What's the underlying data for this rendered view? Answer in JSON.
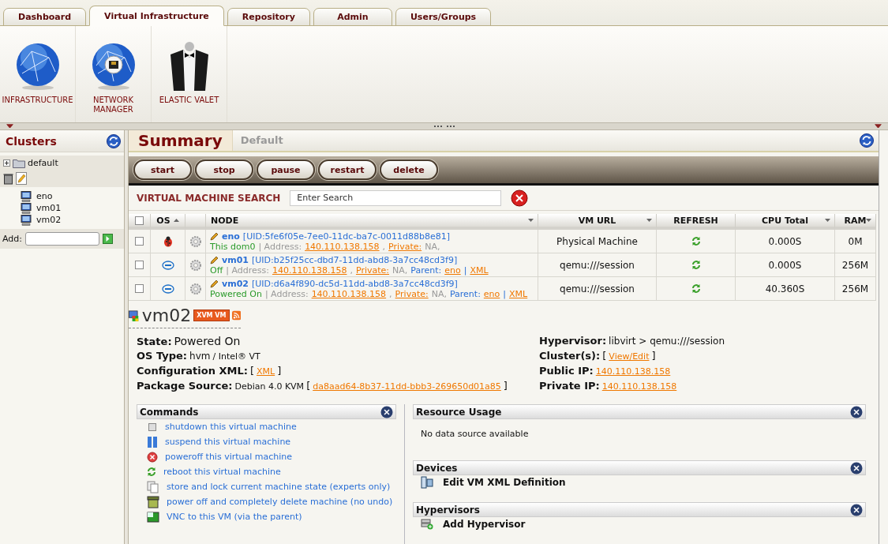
{
  "tabs": [
    {
      "label": "Dashboard",
      "selected": false
    },
    {
      "label": "Virtual Infrastructure",
      "selected": true
    },
    {
      "label": "Repository",
      "selected": false
    },
    {
      "label": "Admin",
      "selected": false
    },
    {
      "label": "Users/Groups",
      "selected": false
    }
  ],
  "launchers": [
    {
      "label": "INFRASTRUCTURE",
      "kind": "globe"
    },
    {
      "label": "NETWORK MANAGER",
      "kind": "network"
    },
    {
      "label": "ELASTIC VALET",
      "kind": "valet"
    }
  ],
  "sidebar": {
    "title": "Clusters",
    "tree": [
      {
        "label": "default",
        "children": [
          {
            "label": "eno"
          },
          {
            "label": "vm01"
          },
          {
            "label": "vm02"
          }
        ]
      }
    ],
    "add_label": "Add:"
  },
  "main": {
    "tabs": [
      {
        "label": "Summary",
        "selected": true
      },
      {
        "label": "Default",
        "selected": false
      }
    ],
    "actions": [
      "start",
      "stop",
      "pause",
      "restart",
      "delete"
    ],
    "search": {
      "title": "VIRTUAL MACHINE SEARCH",
      "placeholder": "Enter Search"
    },
    "table": {
      "select_all": {
        "checked": false
      },
      "columns": [
        {
          "label": "OS",
          "sorted": true,
          "menu": false
        },
        {
          "label": "NODE",
          "sorted": false,
          "menu": true
        },
        {
          "label": "VM URL",
          "sorted": false,
          "menu": true
        },
        {
          "label": "REFRESH",
          "sorted": false,
          "menu": false
        },
        {
          "label": "CPU Total",
          "sorted": false,
          "menu": true
        },
        {
          "label": "RAM",
          "sorted": false,
          "menu": true
        }
      ],
      "rows": [
        {
          "checked": false,
          "kind": "bug",
          "name": "eno",
          "uid": "[UID:5fe6f05e-7ee0-11dc-ba7c-0011d88b8e81]",
          "details": [
            {
              "kind": "status",
              "text": "This dom0"
            },
            {
              "kind": "plain",
              "text": "| Address:"
            },
            {
              "kind": "link",
              "text": "140.110.138.158"
            },
            {
              "kind": "plain",
              "text": ","
            },
            {
              "kind": "link",
              "text": "Private:"
            },
            {
              "kind": "plain",
              "text": "NA,"
            }
          ],
          "vm_url": "Physical Machine",
          "cpu": "0.000S",
          "ram": "0M"
        },
        {
          "checked": false,
          "kind": "intel",
          "name": "vm01",
          "uid": "[UID:b25f25cc-dbd7-11dd-abd8-3a7cc48cd3f9]",
          "details": [
            {
              "kind": "status",
              "text": "Off"
            },
            {
              "kind": "plain",
              "text": "| Address:"
            },
            {
              "kind": "link",
              "text": "140.110.138.158"
            },
            {
              "kind": "plain",
              "text": ","
            },
            {
              "kind": "link",
              "text": "Private:"
            },
            {
              "kind": "plain",
              "text": "NA,"
            },
            {
              "kind": "label",
              "text": "Parent:"
            },
            {
              "kind": "link",
              "text": "eno"
            },
            {
              "kind": "label",
              "text": "|"
            },
            {
              "kind": "link",
              "text": "XML"
            }
          ],
          "vm_url": "qemu:///session",
          "cpu": "0.000S",
          "ram": "256M"
        },
        {
          "checked": false,
          "kind": "intel",
          "name": "vm02",
          "uid": "[UID:d6a4f890-dc5d-11dd-abd8-3a7cc48cd3f9]",
          "details": [
            {
              "kind": "status",
              "text": "Powered On"
            },
            {
              "kind": "plain",
              "text": "| Address:"
            },
            {
              "kind": "link",
              "text": "140.110.138.158"
            },
            {
              "kind": "plain",
              "text": ","
            },
            {
              "kind": "link",
              "text": "Private:"
            },
            {
              "kind": "plain",
              "text": "NA,"
            },
            {
              "kind": "label",
              "text": "Parent:"
            },
            {
              "kind": "link",
              "text": "eno"
            },
            {
              "kind": "label",
              "text": "|"
            },
            {
              "kind": "link",
              "text": "XML"
            }
          ],
          "vm_url": "qemu:///session",
          "cpu": "40.360S",
          "ram": "256M"
        }
      ]
    },
    "detail": {
      "title": "vm02",
      "badge": "XVM VM",
      "left": [
        {
          "label": "State:",
          "value": [
            {
              "kind": "big",
              "text": "Powered On"
            }
          ]
        },
        {
          "label": "OS Type:",
          "value": [
            {
              "kind": "text",
              "text": "hvm"
            },
            {
              "kind": "small",
              "text": "/ Intel® VT"
            }
          ]
        },
        {
          "label": "Configuration XML:",
          "value": [
            {
              "kind": "bracket",
              "text": "["
            },
            {
              "kind": "link",
              "text": "XML"
            },
            {
              "kind": "bracket",
              "text": "]"
            }
          ]
        },
        {
          "label": "Package Source:",
          "value": [
            {
              "kind": "small",
              "text": "Debian 4.0 KVM"
            },
            {
              "kind": "bracket",
              "text": "["
            },
            {
              "kind": "link",
              "text": "da8aad64-8b37-11dd-bbb3-269650d01a85"
            },
            {
              "kind": "bracket",
              "text": "]"
            }
          ]
        }
      ],
      "right": [
        {
          "label": "Hypervisor:",
          "value": [
            {
              "kind": "text",
              "text": "libvirt > qemu:///session"
            }
          ]
        },
        {
          "label": "Cluster(s):",
          "value": [
            {
              "kind": "bracket",
              "text": "["
            },
            {
              "kind": "link",
              "text": "View/Edit"
            },
            {
              "kind": "bracket",
              "text": "]"
            }
          ]
        },
        {
          "label": "Public IP:",
          "value": [
            {
              "kind": "link",
              "text": "140.110.138.158"
            }
          ]
        },
        {
          "label": "Private IP:",
          "value": [
            {
              "kind": "link",
              "text": "140.110.138.158"
            }
          ]
        }
      ]
    },
    "commands": {
      "title": "Commands",
      "items": [
        {
          "kind": "square",
          "label": "shutdown this virtual machine"
        },
        {
          "kind": "pause",
          "label": "suspend this virtual machine"
        },
        {
          "kind": "stop",
          "label": "poweroff this virtual machine"
        },
        {
          "kind": "reboot",
          "label": "reboot this virtual machine"
        },
        {
          "kind": "pages",
          "label": "store and lock current machine state (experts only)"
        },
        {
          "kind": "bin",
          "label": "power off and completely delete machine (no undo)"
        },
        {
          "kind": "vnc",
          "label": "VNC to this VM (via the parent)"
        }
      ]
    },
    "resource_usage": {
      "title": "Resource Usage",
      "message": "No data source available"
    },
    "devices": {
      "title": "Devices",
      "items": [
        "Edit VM XML Definition"
      ]
    },
    "hypervisors": {
      "title": "Hypervisors",
      "items": [
        "Add Hypervisor"
      ]
    }
  }
}
